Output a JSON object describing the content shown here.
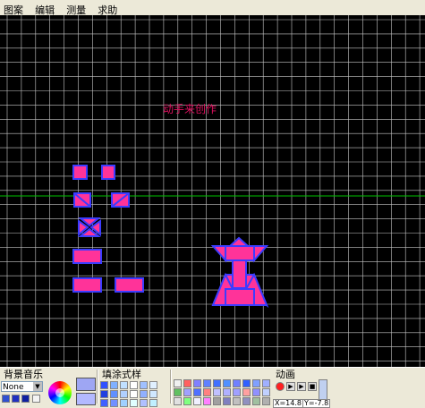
{
  "menu": [
    "图案",
    "编辑",
    "测量",
    "求助"
  ],
  "canvas": {
    "title_text": "动手来创作",
    "title_color": "#e0115f",
    "background": "#000000",
    "grid_color": "#c8c8c8",
    "center_line_color": "#00c000",
    "shape_fill": "#ff3399",
    "shape_stroke": "#3c3cff"
  },
  "bottom_toolbar": {
    "music_label": "背景音乐",
    "music_value": "None",
    "fill_label": "填涂式样",
    "animation_label": "动画",
    "coord_x": "X=14.8",
    "coord_y": "Y=-7.8"
  }
}
